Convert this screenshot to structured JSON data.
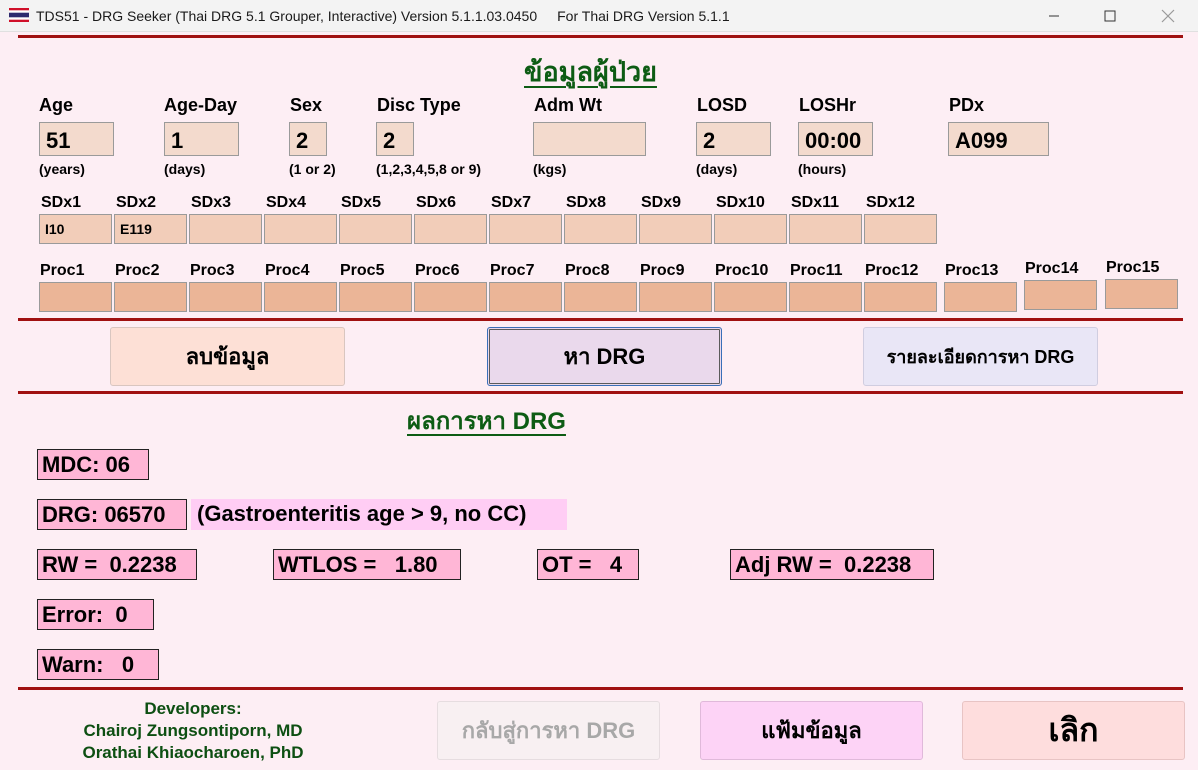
{
  "window": {
    "title": "TDS51 - DRG Seeker (Thai DRG 5.1 Grouper, Interactive) Version 5.1.1.03.0450",
    "subtitle": "For Thai DRG Version 5.1.1"
  },
  "patient": {
    "heading": "ข้อมูลผู้ป่วย",
    "age": {
      "label": "Age",
      "value": "51",
      "hint": "(years)"
    },
    "age_day": {
      "label": "Age-Day",
      "value": "1",
      "hint": "(days)"
    },
    "sex": {
      "label": "Sex",
      "value": "2",
      "hint": "(1 or 2)"
    },
    "disc_type": {
      "label": "Disc Type",
      "value": "2",
      "hint": "(1,2,3,4,5,8 or 9)"
    },
    "adm_wt": {
      "label": "Adm Wt",
      "value": "",
      "hint": "(kgs)"
    },
    "losd": {
      "label": "LOSD",
      "value": "2",
      "hint": "(days)"
    },
    "loshr": {
      "label": "LOSHr",
      "value": "00:00",
      "hint": "(hours)"
    },
    "pdx": {
      "label": "PDx",
      "value": "A099"
    },
    "sdx": [
      {
        "label": "SDx1",
        "value": "I10"
      },
      {
        "label": "SDx2",
        "value": "E119"
      },
      {
        "label": "SDx3",
        "value": ""
      },
      {
        "label": "SDx4",
        "value": ""
      },
      {
        "label": "SDx5",
        "value": ""
      },
      {
        "label": "SDx6",
        "value": ""
      },
      {
        "label": "SDx7",
        "value": ""
      },
      {
        "label": "SDx8",
        "value": ""
      },
      {
        "label": "SDx9",
        "value": ""
      },
      {
        "label": "SDx10",
        "value": ""
      },
      {
        "label": "SDx11",
        "value": ""
      },
      {
        "label": "SDx12",
        "value": ""
      }
    ],
    "proc": [
      {
        "label": "Proc1",
        "value": ""
      },
      {
        "label": "Proc2",
        "value": ""
      },
      {
        "label": "Proc3",
        "value": ""
      },
      {
        "label": "Proc4",
        "value": ""
      },
      {
        "label": "Proc5",
        "value": ""
      },
      {
        "label": "Proc6",
        "value": ""
      },
      {
        "label": "Proc7",
        "value": ""
      },
      {
        "label": "Proc8",
        "value": ""
      },
      {
        "label": "Proc9",
        "value": ""
      },
      {
        "label": "Proc10",
        "value": ""
      },
      {
        "label": "Proc11",
        "value": ""
      },
      {
        "label": "Proc12",
        "value": ""
      },
      {
        "label": "Proc13",
        "value": ""
      },
      {
        "label": "Proc14",
        "value": ""
      },
      {
        "label": "Proc15",
        "value": ""
      }
    ]
  },
  "actions": {
    "clear": "ลบข้อมูล",
    "find": "หา DRG",
    "details": "รายละเอียดการหา DRG"
  },
  "result": {
    "heading": "ผลการหา DRG",
    "mdc": "MDC: 06",
    "drg": "DRG: 06570",
    "drg_desc": "(Gastroenteritis age > 9, no CC)",
    "rw": "RW =  0.2238",
    "wtlos": "WTLOS =   1.80",
    "ot": "OT =   4",
    "adj_rw": "Adj RW =  0.2238",
    "error": "Error:  0",
    "warn": "Warn:   0"
  },
  "footer": {
    "devs_title": "Developers:",
    "dev1": "Chairoj Zungsontiporn, MD",
    "dev2": "Orathai Khiaocharoen, PhD",
    "back": "กลับสู่การหา DRG",
    "datafile": "แฟ้มข้อมูล",
    "quit": "เลิก"
  },
  "colors": {
    "background": "#fdeef4",
    "rule": "#a01010",
    "heading": "#0d5c14",
    "result_box": "#ffb6d6"
  }
}
